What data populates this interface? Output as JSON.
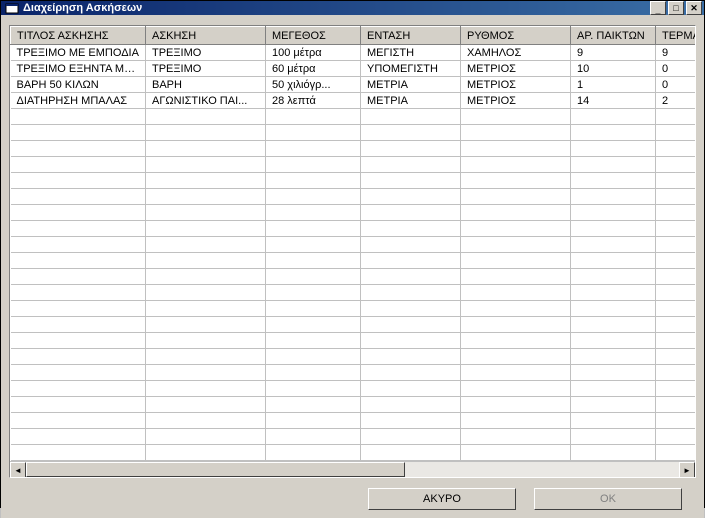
{
  "window": {
    "title": "Διαχείρηση Ασκήσεων"
  },
  "grid": {
    "columns": [
      "ΤΙΤΛΟΣ ΑΣΚΗΣΗΣ",
      "ΑΣΚΗΣΗ",
      "ΜΕΓΕΘΟΣ",
      "ΕΝΤΑΣΗ",
      "ΡΥΘΜΟΣ",
      "ΑΡ. ΠΑΙΚΤΩΝ",
      "ΤΕΡΜΑΤΟΦ..."
    ],
    "rows": [
      {
        "c0": "ΤΡΕΞΙΜΟ ΜΕ ΕΜΠΟΔΙΑ",
        "c1": "ΤΡΕΞΙΜΟ",
        "c2": "100 μέτρα",
        "c3": "ΜΕΓΙΣΤΗ",
        "c4": "ΧΑΜΗΛΟΣ",
        "c5": "9",
        "c6": "9"
      },
      {
        "c0": "ΤΡΕΞΙΜΟ ΕΞΗΝΤΑ ΜΕΤ...",
        "c1": "ΤΡΕΞΙΜΟ",
        "c2": "60 μέτρα",
        "c3": "ΥΠΟΜΕΓΙΣΤΗ",
        "c4": "ΜΕΤΡΙΟΣ",
        "c5": "10",
        "c6": "0"
      },
      {
        "c0": "ΒΑΡΗ 50 ΚΙΛΩΝ",
        "c1": "ΒΑΡΗ",
        "c2": "50 χιλιόγρ...",
        "c3": "ΜΕΤΡΙΑ",
        "c4": "ΜΕΤΡΙΟΣ",
        "c5": "1",
        "c6": "0"
      },
      {
        "c0": "ΔΙΑΤΗΡΗΣΗ ΜΠΑΛΑΣ",
        "c1": "ΑΓΩΝΙΣΤΙΚΟ ΠΑΙ...",
        "c2": "28 λεπτά",
        "c3": "ΜΕΤΡΙΑ",
        "c4": "ΜΕΤΡΙΟΣ",
        "c5": "14",
        "c6": "2"
      }
    ],
    "empty_row_count": 22
  },
  "buttons": {
    "cancel": "ΑΚΥΡΟ",
    "ok": "OK"
  },
  "titlebar_controls": {
    "minimize": "_",
    "maximize": "□",
    "close": "✕"
  },
  "scroll": {
    "left": "◄",
    "right": "►"
  }
}
